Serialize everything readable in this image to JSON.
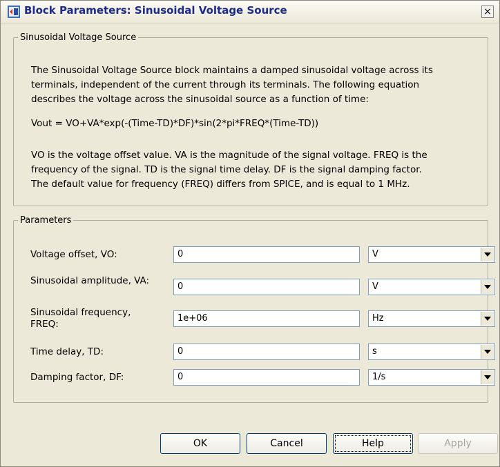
{
  "window": {
    "title": "Block Parameters: Sinusoidal Voltage Source",
    "close_glyph": "×"
  },
  "description": {
    "legend": "Sinusoidal Voltage Source",
    "lines": [
      "The Sinusoidal Voltage Source block maintains a damped sinusoidal voltage across its",
      "terminals, independent of the current through its terminals. The following equation",
      "describes the voltage across the sinusoidal source as a function of time:",
      "Vout = VO+VA*exp(-(Time-TD)*DF)*sin(2*pi*FREQ*(Time-TD))",
      "VO is the voltage offset value. VA is the magnitude of the signal voltage. FREQ is the",
      "frequency of the signal. TD is the signal time delay. DF is the signal damping factor.",
      "The default value for frequency (FREQ) differs from SPICE, and is equal to 1 MHz."
    ]
  },
  "parameters": {
    "legend": "Parameters",
    "rows": [
      {
        "label": "Voltage offset, VO:",
        "value": "0",
        "unit": "V"
      },
      {
        "label": "Sinusoidal amplitude, VA:",
        "value": "0",
        "unit": "V"
      },
      {
        "label": "Sinusoidal frequency, FREQ:",
        "value": "1e+06",
        "unit": "Hz"
      },
      {
        "label": "Time delay, TD:",
        "value": "0",
        "unit": "s"
      },
      {
        "label": "Damping factor, DF:",
        "value": "0",
        "unit": "1/s"
      }
    ]
  },
  "buttons": {
    "ok": "OK",
    "cancel": "Cancel",
    "help": "Help",
    "apply": "Apply"
  }
}
